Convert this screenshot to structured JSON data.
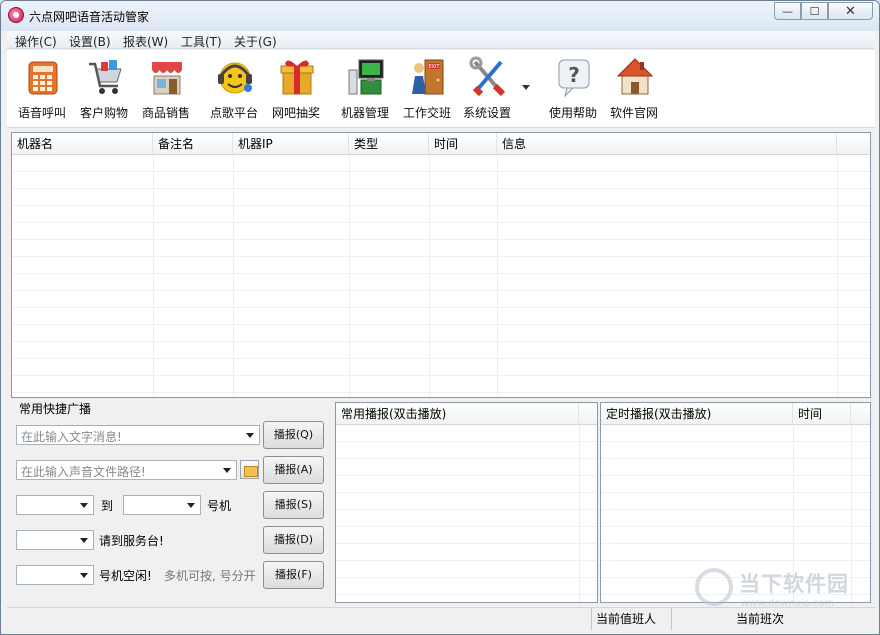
{
  "window": {
    "title": "六点网吧语音活动管家"
  },
  "title_buttons": {
    "minimize": "—",
    "maximize": "☐",
    "close": "✕"
  },
  "menu": [
    {
      "label": "操作(C)"
    },
    {
      "label": "设置(B)"
    },
    {
      "label": "报表(W)"
    },
    {
      "label": "工具(T)"
    },
    {
      "label": "关于(G)"
    }
  ],
  "toolbar": [
    {
      "label": "语音呼叫",
      "icon": "telephone-icon"
    },
    {
      "label": "客户购物",
      "icon": "shopping-cart-icon"
    },
    {
      "label": "商品销售",
      "icon": "storefront-icon"
    },
    {
      "label": "点歌平台",
      "icon": "headset-smiley-icon"
    },
    {
      "label": "网吧抽奖",
      "icon": "gift-box-icon"
    },
    {
      "label": "机器管理",
      "icon": "computer-icon"
    },
    {
      "label": "工作交班",
      "icon": "exit-door-icon"
    },
    {
      "label": "系统设置",
      "icon": "tools-icon"
    },
    {
      "label": "使用帮助",
      "icon": "help-bubble-icon"
    },
    {
      "label": "软件官网",
      "icon": "house-icon"
    }
  ],
  "main_table": {
    "columns": [
      "机器名",
      "备注名",
      "机器IP",
      "类型",
      "时间",
      "信息"
    ],
    "rows": []
  },
  "broadcast": {
    "group_title": "常用快捷广播",
    "text_message_placeholder": "在此输入文字消息!",
    "sound_path_placeholder": "在此输入声音文件路径!",
    "to_label": "到",
    "machine_label": "号机",
    "service_desk_label": "请到服务台!",
    "idle_label": "号机空闲!",
    "hint_label": "多机可按, 号分开",
    "buttons": [
      "播报(Q)",
      "播报(A)",
      "播报(S)",
      "播报(D)",
      "播报(F)"
    ]
  },
  "common_broadcast_panel": {
    "columns": [
      "常用播报(双击播放)"
    ]
  },
  "timed_broadcast_panel": {
    "columns": [
      "定时播报(双击播放)",
      "时间"
    ]
  },
  "statusbar": {
    "on_duty": "当前值班人",
    "shift": "当前班次"
  },
  "watermark": {
    "text": "当下软件园",
    "url": "www.downxia.com"
  }
}
